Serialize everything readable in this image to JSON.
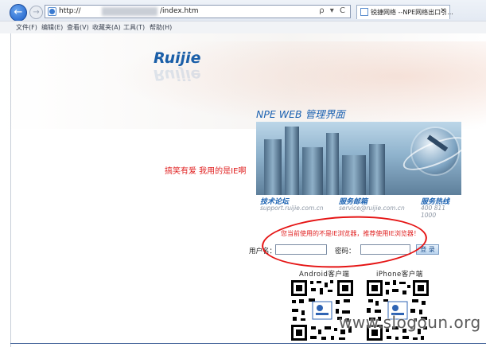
{
  "browser": {
    "url_prefix": "http://",
    "url_suffix": "/index.htm",
    "tab_label": "锐捷网络 --NPE网络出口引...",
    "tab_close": "✕",
    "addr_tools": "ρ ▾ C",
    "menu": [
      "文件(F)",
      "编辑(E)",
      "查看(V)",
      "收藏夹(A)",
      "工具(T)",
      "帮助(H)"
    ]
  },
  "page": {
    "logo": "Ruijie",
    "panel_title": "NPE WEB  管理界面",
    "info": [
      {
        "title": "技术论坛",
        "sub": "support.ruijie.com.cn"
      },
      {
        "title": "服务邮箱",
        "sub": "service@ruijie.com.cn"
      },
      {
        "title": "服务热线",
        "sub": "400 811 1000"
      }
    ],
    "ie_note": "搞笑有爱  我用的是IE啊",
    "warning": "您当前使用的不是IE浏览器，推荐使用IE浏览器！",
    "login": {
      "username_label": "用户名：",
      "password_label": "密码：",
      "username_value": "",
      "password_value": "",
      "submit_label": "登 录"
    },
    "qr": [
      {
        "label": "Android客户端"
      },
      {
        "label": "iPhone客户端"
      }
    ],
    "watermark": "www.slogoun.org"
  },
  "colors": {
    "accent": "#1d63b2",
    "warning": "#e01f1f",
    "annotation_circle": "#e51414"
  }
}
